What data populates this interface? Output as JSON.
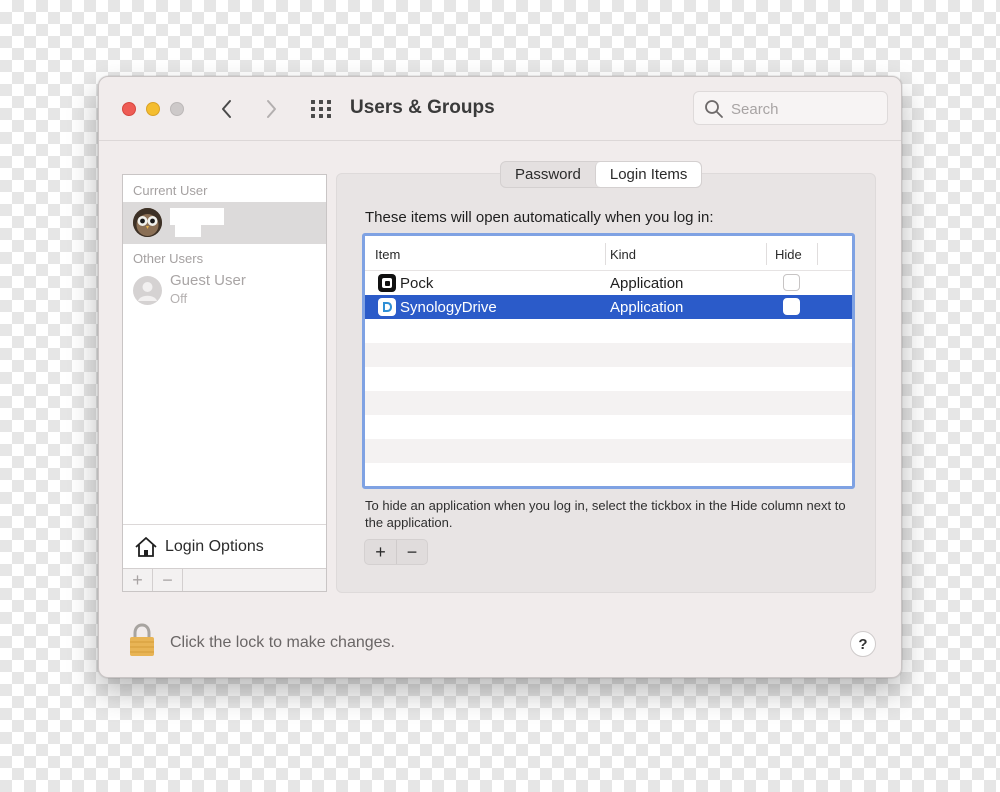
{
  "window": {
    "title": "Users & Groups",
    "search_placeholder": "Search"
  },
  "sidebar": {
    "current_user_header": "Current User",
    "other_users_header": "Other Users",
    "guest": {
      "name": "Guest User",
      "status": "Off"
    },
    "login_options_label": "Login Options",
    "add_symbol": "+",
    "remove_symbol": "−"
  },
  "tabs": [
    {
      "label": "Password",
      "active": false
    },
    {
      "label": "Login Items",
      "active": true
    }
  ],
  "login_items": {
    "intro": "These items will open automatically when you log in:",
    "columns": {
      "item": "Item",
      "kind": "Kind",
      "hide": "Hide"
    },
    "rows": [
      {
        "item": "Pock",
        "kind": "Application",
        "hide": false,
        "selected": false,
        "icon": "pock-app-icon"
      },
      {
        "item": "SynologyDrive",
        "kind": "Application",
        "hide": false,
        "selected": true,
        "icon": "synology-drive-app-icon"
      }
    ],
    "hint": "To hide an application when you log in, select the tickbox in the Hide column next to the application.",
    "add_symbol": "+",
    "remove_symbol": "−"
  },
  "footer": {
    "lock_text": "Click the lock to make changes.",
    "help_symbol": "?"
  },
  "colors": {
    "selection": "#2b5bc9",
    "table_focus_ring": "#7fa2e3",
    "close": "#ee5c55",
    "minimize": "#f4bd2f"
  }
}
